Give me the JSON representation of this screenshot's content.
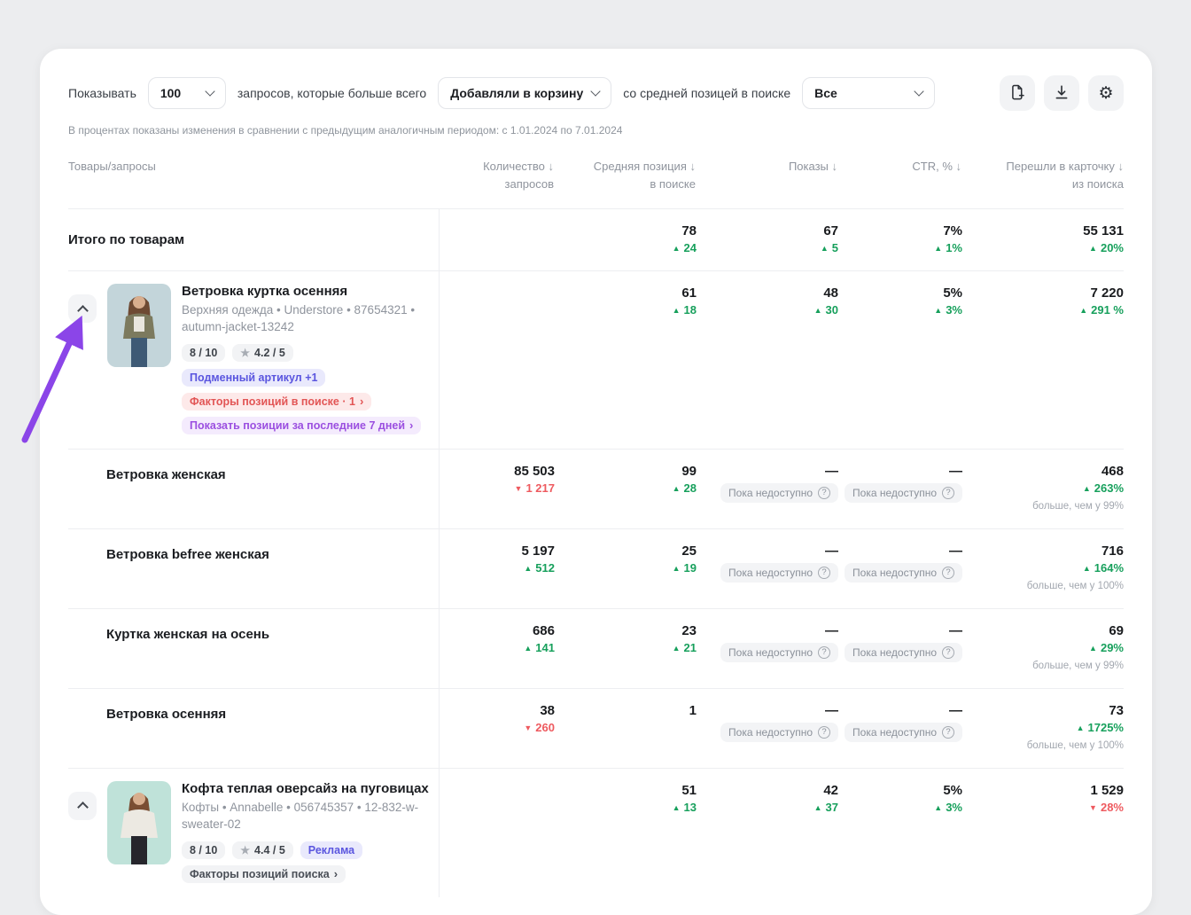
{
  "toolbar": {
    "show_label": "Показывать",
    "count_value": "100",
    "queries_label": "запросов, которые больше всего",
    "action_value": "Добавляли в корзину",
    "position_label": "со средней позицей в поиске",
    "position_value": "Все"
  },
  "note": "В процентах показаны изменения в сравнении с предыдущим аналогичным периодом: с 1.01.2024 по 7.01.2024",
  "strings": {
    "unavailable": "Пока недоступно",
    "dash": "—",
    "sort": "↓",
    "q": "?",
    "chevron": "›",
    "star": "★",
    "gear": "⚙"
  },
  "colors": {
    "accent_purple": "#8B45E8",
    "green": "#17A05C",
    "red": "#EE5A5F"
  },
  "table": {
    "headers": {
      "products": "Товары/запросы",
      "quantity_l1": "Количество",
      "quantity_l2": "запросов",
      "position_l1": "Средняя позиция",
      "position_l2": "в поиске",
      "impressions": "Показы",
      "ctr": "CTR, %",
      "transitions_l1": "Перешли в карточку",
      "transitions_l2": "из поиска"
    },
    "rows": [
      {
        "type": "summary",
        "label": "Итого по товарам",
        "c2": {
          "v": "78",
          "d": "24",
          "dir": "up"
        },
        "c3": {
          "v": "67",
          "d": "5",
          "dir": "up"
        },
        "c4": {
          "v": "7%",
          "d": "1%",
          "dir": "up"
        },
        "c5": {
          "v": "55 131",
          "d": "20%",
          "dir": "up"
        }
      },
      {
        "type": "product",
        "title": "Ветровка куртка осенняя",
        "subtitle": "Верхняя одежда • Understore • 87654321 • autumn-jacket-13242",
        "score": "8 / 10",
        "rating": "4.2 / 5",
        "tag": "Подменный артикул +1",
        "factor_badge": "Факторы позиций в поиске · 1",
        "purple_badge": "Показать позиции за последние 7 дней",
        "c2": {
          "v": "61",
          "d": "18",
          "dir": "up"
        },
        "c3": {
          "v": "48",
          "d": "30",
          "dir": "up"
        },
        "c4": {
          "v": "5%",
          "d": "3%",
          "dir": "up"
        },
        "c5": {
          "v": "7 220",
          "d": "291 %",
          "dir": "up"
        }
      },
      {
        "type": "query",
        "label": "Ветровка женская",
        "c1": {
          "v": "85 503",
          "d": "1 217",
          "dir": "down"
        },
        "c2": {
          "v": "99",
          "d": "28",
          "dir": "up"
        },
        "c5": {
          "v": "468",
          "d": "263%",
          "dir": "up",
          "note": "больше, чем у 99%"
        }
      },
      {
        "type": "query",
        "label": "Ветровка befree женская",
        "c1": {
          "v": "5 197",
          "d": "512",
          "dir": "up"
        },
        "c2": {
          "v": "25",
          "d": "19",
          "dir": "up"
        },
        "c5": {
          "v": "716",
          "d": "164%",
          "dir": "up",
          "note": "больше, чем у 100%"
        }
      },
      {
        "type": "query",
        "label": "Куртка женская на осень",
        "c1": {
          "v": "686",
          "d": "141",
          "dir": "up"
        },
        "c2": {
          "v": "23",
          "d": "21",
          "dir": "up"
        },
        "c5": {
          "v": "69",
          "d": "29%",
          "dir": "up",
          "note": "больше, чем у 99%"
        }
      },
      {
        "type": "query",
        "label": "Ветровка осенняя",
        "c1": {
          "v": "38",
          "d": "260",
          "dir": "down"
        },
        "c2": {
          "v": "1"
        },
        "c5": {
          "v": "73",
          "d": "1725%",
          "dir": "up",
          "note": "больше, чем у 100%"
        }
      },
      {
        "type": "product",
        "title": "Кофта теплая оверсайз на пуговицах",
        "subtitle": "Кофты • Annabelle • 056745357 • 12-832-w-sweater-02",
        "score": "8 / 10",
        "rating": "4.4 / 5",
        "tag": "Реклама",
        "gray_badge": "Факторы позиций поиска",
        "c2": {
          "v": "51",
          "d": "13",
          "dir": "up"
        },
        "c3": {
          "v": "42",
          "d": "37",
          "dir": "up"
        },
        "c4": {
          "v": "5%",
          "d": "3%",
          "dir": "up"
        },
        "c5": {
          "v": "1 529",
          "d": "28%",
          "dir": "down"
        }
      }
    ]
  }
}
